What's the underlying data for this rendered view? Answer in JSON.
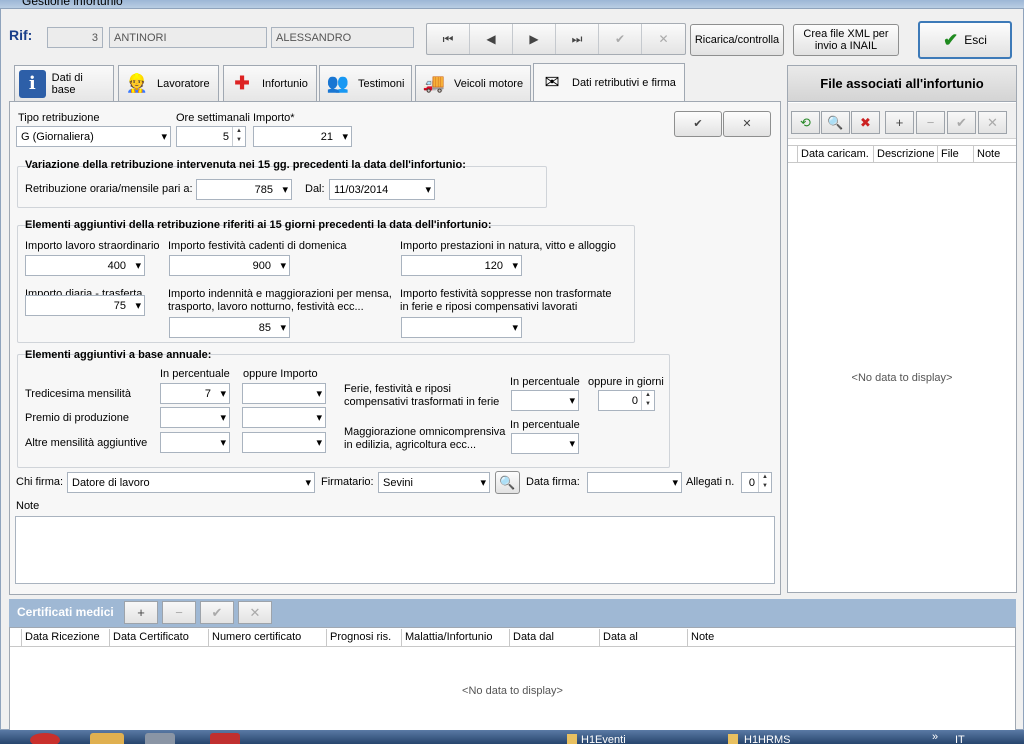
{
  "window": {
    "title": "Gestione infortunio"
  },
  "header": {
    "rif_label": "Rif:",
    "rif_number": "3",
    "surname": "ANTINORI",
    "name": "ALESSANDRO",
    "ricarica_label": "Ricarica/controlla",
    "xml_label": "Crea file XML per invio a INAIL",
    "esci_label": "Esci"
  },
  "tabs": [
    {
      "label": "Dati di base",
      "icon": "info-icon"
    },
    {
      "label": "Lavoratore",
      "icon": "worker-icon"
    },
    {
      "label": "Infortunio",
      "icon": "first-aid-icon"
    },
    {
      "label": "Testimoni",
      "icon": "people-icon"
    },
    {
      "label": "Veicoli motore",
      "icon": "truck-icon"
    },
    {
      "label": "Dati retributivi e firma",
      "icon": "envelope-icon"
    }
  ],
  "form": {
    "tipo_label": "Tipo retribuzione",
    "tipo_value": "G (Giornaliera)",
    "ore_label": "Ore settimanali",
    "ore_value": "5",
    "importo_label": "Importo*",
    "importo_value": "21",
    "variazione": {
      "title": "Variazione della retribuzione intervenuta nei 15 gg. precedenti la data dell'infortunio:",
      "retr_label": "Retribuzione oraria/mensile pari a:",
      "retr_value": "785",
      "dal_label": "Dal:",
      "dal_value": "11/03/2014"
    },
    "elementi15": {
      "title": "Elementi aggiuntivi della retribuzione riferiti ai 15 giorni precedenti la data dell'infortunio:",
      "straord_label": "Importo lavoro straordinario",
      "straord_value": "400",
      "festivita_label": "Importo festività cadenti di domenica",
      "festivita_value": "900",
      "natura_label": "Importo prestazioni in natura, vitto e alloggio",
      "natura_value": "120",
      "diaria_label": "Importo diaria - trasferta",
      "diaria_value": "75",
      "indennita_label1": "Importo indennità e maggiorazioni per mensa,",
      "indennita_label2": "trasporto, lavoro notturno, festività ecc...",
      "indennita_value": "85",
      "soppresse_label1": "Importo festività soppresse non trasformate",
      "soppresse_label2": "in ferie e riposi compensativi lavorati"
    },
    "annuali": {
      "title": "Elementi aggiuntivi a base annuale:",
      "perc_header": "In percentuale",
      "imp_header": "oppure Importo",
      "tredicesima_label": "Tredicesima mensilità",
      "tredicesima_perc": "7",
      "premio_label": "Premio di produzione",
      "altre_label": "Altre mensilità aggiuntive",
      "ferie_label1": "Ferie, festività e riposi",
      "ferie_label2": "compensativi trasformati in ferie",
      "ferie_perc_header": "In percentuale",
      "giorni_header": "oppure in giorni",
      "giorni_value": "0",
      "omni_label1": "Maggiorazione omnicomprensiva",
      "omni_label2": "in edilizia, agricoltura ecc...",
      "omni_perc_header": "In percentuale"
    },
    "chi_firma_label": "Chi firma:",
    "chi_firma_value": "Datore di lavoro",
    "firmatario_label": "Firmatario:",
    "firmatario_value": "Sevini",
    "data_firma_label": "Data firma:",
    "allegati_label": "Allegati n.",
    "allegati_value": "0",
    "note_label": "Note"
  },
  "files_panel": {
    "title": "File associati all'infortunio",
    "columns": [
      "Data caricam.",
      "Descrizione",
      "File",
      "Note"
    ],
    "empty": "<No data to display>"
  },
  "certificati": {
    "title": "Certificati medici",
    "columns": [
      "Data Ricezione",
      "Data Certificato",
      "Numero certificato",
      "Prognosi ris.",
      "Malattia/Infortunio",
      "Data dal",
      "Data al",
      "Note"
    ],
    "empty": "<No data to display>"
  },
  "taskbar": {
    "items": [
      "H1Eventi",
      "H1HRMS"
    ],
    "lang": "IT"
  }
}
